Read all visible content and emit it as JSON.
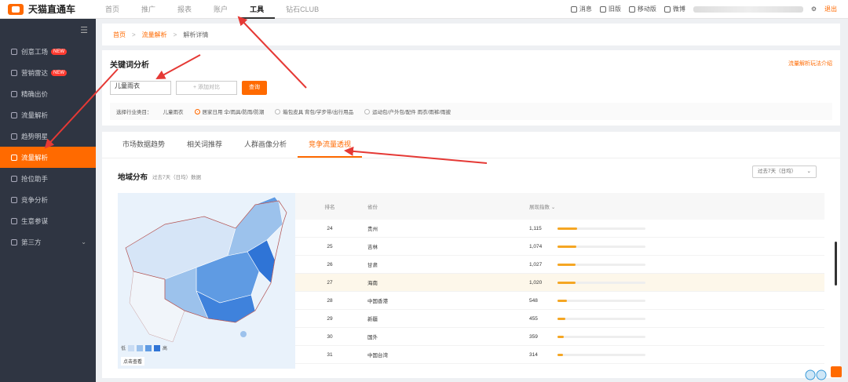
{
  "app": {
    "name": "天猫直通车"
  },
  "nav": [
    "首页",
    "推广",
    "报表",
    "账户",
    "工具",
    "钻石CLUB"
  ],
  "nav_active": 4,
  "top_right": {
    "items": [
      "消息",
      "旧版",
      "移动版",
      "微博"
    ],
    "logout": "退出"
  },
  "sidebar": {
    "items": [
      {
        "label": "创意工场",
        "badge": "NEW"
      },
      {
        "label": "营销雷达",
        "badge": "NEW"
      },
      {
        "label": "精确出价",
        "badge": ""
      },
      {
        "label": "流量解析",
        "badge": ""
      },
      {
        "label": "趋势明星",
        "badge": ""
      },
      {
        "label": "流量解析",
        "badge": "",
        "active": true
      },
      {
        "label": "抢位助手",
        "badge": ""
      },
      {
        "label": "竞争分析",
        "badge": ""
      },
      {
        "label": "生意参谋",
        "badge": ""
      },
      {
        "label": "第三方",
        "badge": "",
        "expand": true
      }
    ]
  },
  "breadcrumb": {
    "home": "首页",
    "section": "流量解析",
    "current": "解析详情"
  },
  "keyword": {
    "title": "关键词分析",
    "guide_link": "流量解析玩法介绍",
    "input_value": "儿童雨衣",
    "compare_label": "+ 添加对比",
    "query_button": "查询",
    "industry_label": "选择行业类目：",
    "industry_keyword": "儿童雨衣",
    "industry_options": [
      {
        "label": "居家日用 伞/雨具/防雨/防潮",
        "selected": true
      },
      {
        "label": "箱包皮具 背包/学步带/出行用品",
        "selected": false
      },
      {
        "label": "运动包/户外包/配件 雨衣/雨裤/雨披",
        "selected": false
      }
    ]
  },
  "tabs": [
    "市场数据趋势",
    "相关词推荐",
    "人群画像分析",
    "竞争流量透视"
  ],
  "tab_active": 3,
  "geo": {
    "title": "地域分布",
    "subtitle": "过去7天（日均）数据",
    "period": "过去7天（日均）",
    "legend_low": "低",
    "legend_high": "高",
    "map_mode": "点击查看",
    "legend_colors": [
      "#c9dcf3",
      "#9cc2ec",
      "#5f9be3",
      "#2f74d6"
    ]
  },
  "table": {
    "headers": {
      "rank": "排名",
      "province": "省份",
      "index": "展现指数"
    },
    "max": 5000,
    "rows": [
      {
        "rank": "24",
        "province": "贵州",
        "value": 1115,
        "label": "1,115"
      },
      {
        "rank": "25",
        "province": "吉林",
        "value": 1074,
        "label": "1,074"
      },
      {
        "rank": "26",
        "province": "甘肃",
        "value": 1027,
        "label": "1,027"
      },
      {
        "rank": "27",
        "province": "海南",
        "value": 1020,
        "label": "1,020",
        "highlight": true
      },
      {
        "rank": "28",
        "province": "中国香港",
        "value": 548,
        "label": "548"
      },
      {
        "rank": "29",
        "province": "新疆",
        "value": 455,
        "label": "455"
      },
      {
        "rank": "30",
        "province": "国外",
        "value": 359,
        "label": "359"
      },
      {
        "rank": "31",
        "province": "中国台湾",
        "value": 314,
        "label": "314"
      }
    ]
  },
  "colors": {
    "accent": "#ff6a00",
    "bar": "#f5a623",
    "sidebar": "#2f3542"
  }
}
